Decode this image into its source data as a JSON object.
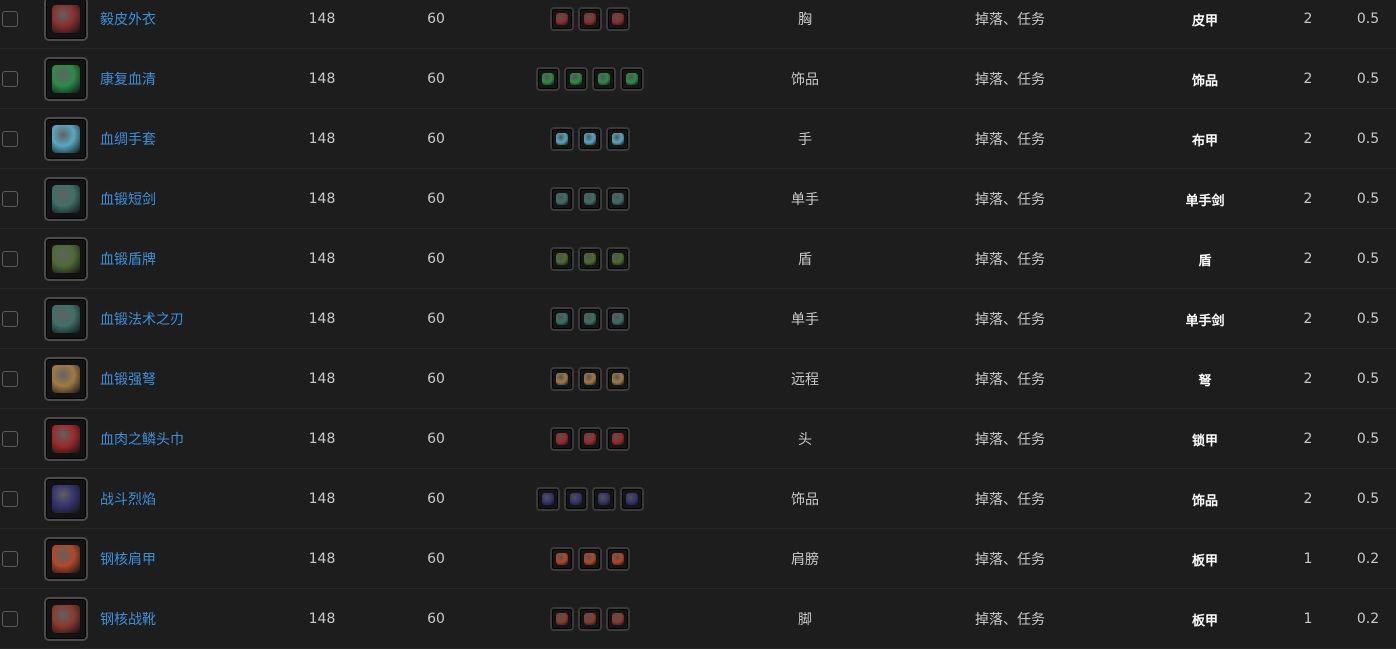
{
  "rows": [
    {
      "name": "毅皮外衣",
      "ilvl": "148",
      "req": "60",
      "slot": "胸",
      "source": "掉落、任务",
      "type": "皮甲",
      "n1": "2",
      "n2": "0.5",
      "socket_count": 3,
      "icon_color": "#8a2f2f",
      "icon_name": "chest-armor-icon"
    },
    {
      "name": "康复血清",
      "ilvl": "148",
      "req": "60",
      "slot": "饰品",
      "source": "掉落、任务",
      "type": "饰品",
      "n1": "2",
      "n2": "0.5",
      "socket_count": 4,
      "icon_color": "#2f8a4a",
      "icon_name": "potion-vial-icon"
    },
    {
      "name": "血绸手套",
      "ilvl": "148",
      "req": "60",
      "slot": "手",
      "source": "掉落、任务",
      "type": "布甲",
      "n1": "2",
      "n2": "0.5",
      "socket_count": 3,
      "icon_color": "#5aa7c0",
      "icon_name": "gloves-icon"
    },
    {
      "name": "血锻短剑",
      "ilvl": "148",
      "req": "60",
      "slot": "单手",
      "source": "掉落、任务",
      "type": "单手剑",
      "n1": "2",
      "n2": "0.5",
      "socket_count": 3,
      "icon_color": "#3f6f68",
      "icon_name": "sword-icon"
    },
    {
      "name": "血锻盾牌",
      "ilvl": "148",
      "req": "60",
      "slot": "盾",
      "source": "掉落、任务",
      "type": "盾",
      "n1": "2",
      "n2": "0.5",
      "socket_count": 3,
      "icon_color": "#4f6a36",
      "icon_name": "shield-icon"
    },
    {
      "name": "血锻法术之刃",
      "ilvl": "148",
      "req": "60",
      "slot": "单手",
      "source": "掉落、任务",
      "type": "单手剑",
      "n1": "2",
      "n2": "0.5",
      "socket_count": 3,
      "icon_color": "#3f6f68",
      "icon_name": "sword-icon"
    },
    {
      "name": "血锻强弩",
      "ilvl": "148",
      "req": "60",
      "slot": "远程",
      "source": "掉落、任务",
      "type": "弩",
      "n1": "2",
      "n2": "0.5",
      "socket_count": 3,
      "icon_color": "#a07a46",
      "icon_name": "crossbow-icon"
    },
    {
      "name": "血肉之鳞头巾",
      "ilvl": "148",
      "req": "60",
      "slot": "头",
      "source": "掉落、任务",
      "type": "锁甲",
      "n1": "2",
      "n2": "0.5",
      "socket_count": 3,
      "icon_color": "#9a2a2a",
      "icon_name": "helmet-icon"
    },
    {
      "name": "战斗烈焰",
      "ilvl": "148",
      "req": "60",
      "slot": "饰品",
      "source": "掉落、任务",
      "type": "饰品",
      "n1": "2",
      "n2": "0.5",
      "socket_count": 4,
      "icon_color": "#34346e",
      "icon_name": "flame-icon"
    },
    {
      "name": "钢核肩甲",
      "ilvl": "148",
      "req": "60",
      "slot": "肩膀",
      "source": "掉落、任务",
      "type": "板甲",
      "n1": "1",
      "n2": "0.2",
      "socket_count": 3,
      "icon_color": "#b0482a",
      "icon_name": "shoulder-armor-icon"
    },
    {
      "name": "钢核战靴",
      "ilvl": "148",
      "req": "60",
      "slot": "脚",
      "source": "掉落、任务",
      "type": "板甲",
      "n1": "1",
      "n2": "0.2",
      "socket_count": 3,
      "icon_color": "#8a3a30",
      "icon_name": "boots-icon"
    }
  ]
}
